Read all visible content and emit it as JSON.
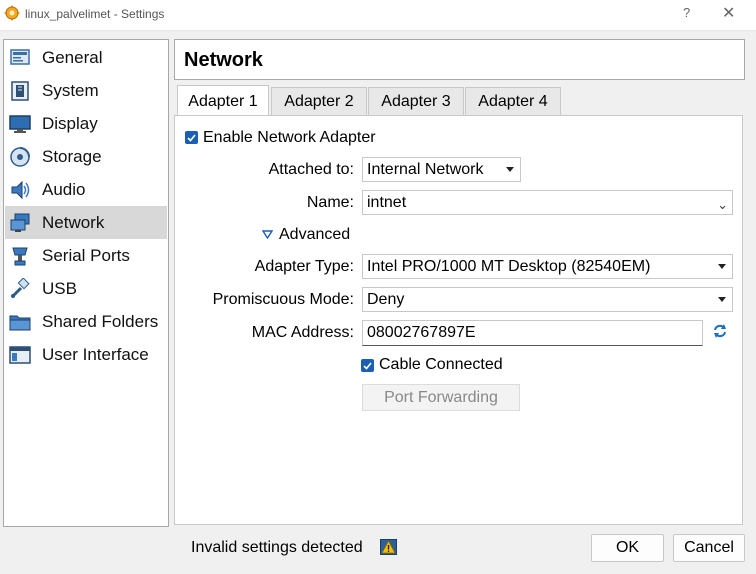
{
  "window": {
    "title": "linux_palvelimet - Settings",
    "help_label": "?",
    "close_label": "✕"
  },
  "sidebar": {
    "items": [
      {
        "label": "General",
        "icon": "general-icon"
      },
      {
        "label": "System",
        "icon": "system-icon"
      },
      {
        "label": "Display",
        "icon": "display-icon"
      },
      {
        "label": "Storage",
        "icon": "storage-icon"
      },
      {
        "label": "Audio",
        "icon": "audio-icon"
      },
      {
        "label": "Network",
        "icon": "network-icon",
        "selected": true
      },
      {
        "label": "Serial Ports",
        "icon": "serial-ports-icon"
      },
      {
        "label": "USB",
        "icon": "usb-icon"
      },
      {
        "label": "Shared Folders",
        "icon": "shared-folders-icon"
      },
      {
        "label": "User Interface",
        "icon": "user-interface-icon"
      }
    ]
  },
  "header": {
    "title": "Network"
  },
  "tabs": [
    {
      "label": "Adapter 1",
      "active": true
    },
    {
      "label": "Adapter 2"
    },
    {
      "label": "Adapter 3"
    },
    {
      "label": "Adapter 4"
    }
  ],
  "form": {
    "enable_adapter": {
      "label": "Enable Network Adapter",
      "checked": true
    },
    "attached_to": {
      "label": "Attached to:",
      "value": "Internal Network"
    },
    "name": {
      "label": "Name:",
      "value": "intnet"
    },
    "advanced": {
      "label": "Advanced",
      "expanded": true
    },
    "adapter_type": {
      "label": "Adapter Type:",
      "value": "Intel PRO/1000 MT Desktop (82540EM)"
    },
    "promiscuous_mode": {
      "label": "Promiscuous Mode:",
      "value": "Deny"
    },
    "mac_address": {
      "label": "MAC Address:",
      "value": "08002767897E"
    },
    "cable_connected": {
      "label": "Cable Connected",
      "checked": true
    },
    "port_forwarding": {
      "label": "Port Forwarding",
      "enabled": false
    }
  },
  "footer": {
    "status": "Invalid settings detected",
    "ok_label": "OK",
    "cancel_label": "Cancel"
  },
  "colors": {
    "accent": "#1a5fb4",
    "selected_bg": "#d8d8d8",
    "window_bg": "#f0f0f0"
  }
}
